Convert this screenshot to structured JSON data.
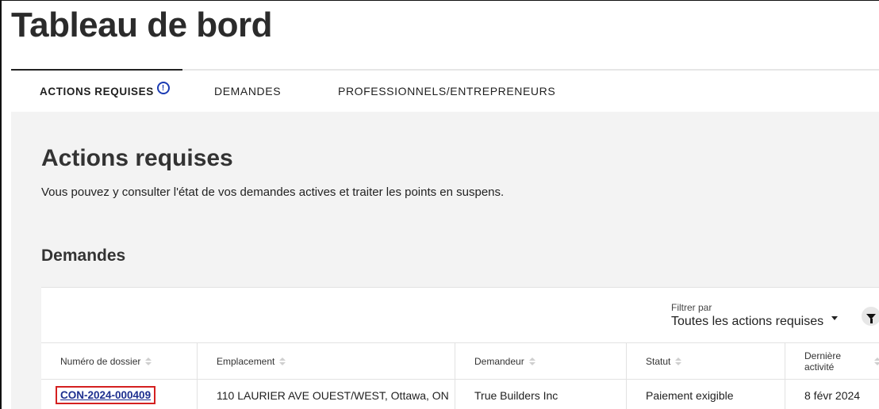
{
  "page": {
    "title": "Tableau de bord"
  },
  "tabs": [
    {
      "label": "ACTIONS REQUISES",
      "active": true,
      "icon": "info-circle-icon"
    },
    {
      "label": "DEMANDES",
      "active": false
    },
    {
      "label": "PROFESSIONNELS/ENTREPRENEURS",
      "active": false
    }
  ],
  "section": {
    "title": "Actions requises",
    "description": "Vous pouvez y consulter l'état de vos demandes actives et traiter les points en suspens.",
    "subtitle": "Demandes"
  },
  "filter": {
    "label": "Filtrer par",
    "selected": "Toutes les actions requises",
    "icon": "filter-funnel-icon"
  },
  "table": {
    "columns": [
      "Numéro de dossier",
      "Emplacement",
      "Demandeur",
      "Statut",
      "Dernière activité"
    ],
    "rows": [
      {
        "case_number": "CON-2024-000409",
        "location": "110 LAURIER AVE OUEST/WEST, Ottawa, ON",
        "applicant": "True Builders Inc",
        "status": "Paiement exigible",
        "last_activity": "8 févr 2024"
      }
    ]
  },
  "colors": {
    "link": "#1d2f8f",
    "highlight_border": "#d42020",
    "info_icon": "#1a3bb3",
    "panel_bg": "#f3f3f3"
  }
}
